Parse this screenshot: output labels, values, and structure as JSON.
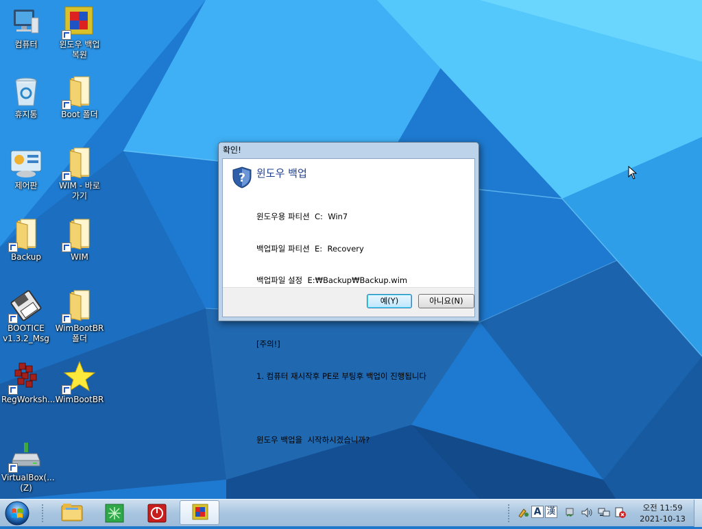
{
  "desktop": {
    "icons": [
      {
        "label": "컴퓨터"
      },
      {
        "label": "윈도우 백업\n복원"
      },
      {
        "label": "휴지통"
      },
      {
        "label": "Boot 폴더"
      },
      {
        "label": "제어판"
      },
      {
        "label": "WIM - 바로\n가기"
      },
      {
        "label": "Backup"
      },
      {
        "label": "WIM"
      },
      {
        "label": "BOOTICE\nv1.3.2_Msg"
      },
      {
        "label": "WimBootBR\n폴더"
      },
      {
        "label": "RegWorksh..."
      },
      {
        "label": "WimBootBR"
      },
      {
        "label": "VirtualBox(...\n(Z)"
      }
    ]
  },
  "dialog": {
    "title": "확인!",
    "heading": "윈도우 백업",
    "lines": [
      "윈도우용 파티션  C:  Win7",
      "백업파일 파티션  E:  Recovery",
      "백업파일 설정  E:₩Backup₩Backup.wim",
      "",
      "[주의!]",
      "1. 컴퓨터 재시작후 PE로 부팅후 백업이 진행됩니다",
      "",
      "윈도우 백업을  시작하시겠습니까?"
    ],
    "yes_label": "예(Y)",
    "no_label": "아니요(N)"
  },
  "taskbar": {
    "tray": {
      "ime_mode": "A",
      "ime_hanja": "漢"
    },
    "clock": {
      "time": "오전 11:59",
      "date": "2021-10-13"
    }
  }
}
